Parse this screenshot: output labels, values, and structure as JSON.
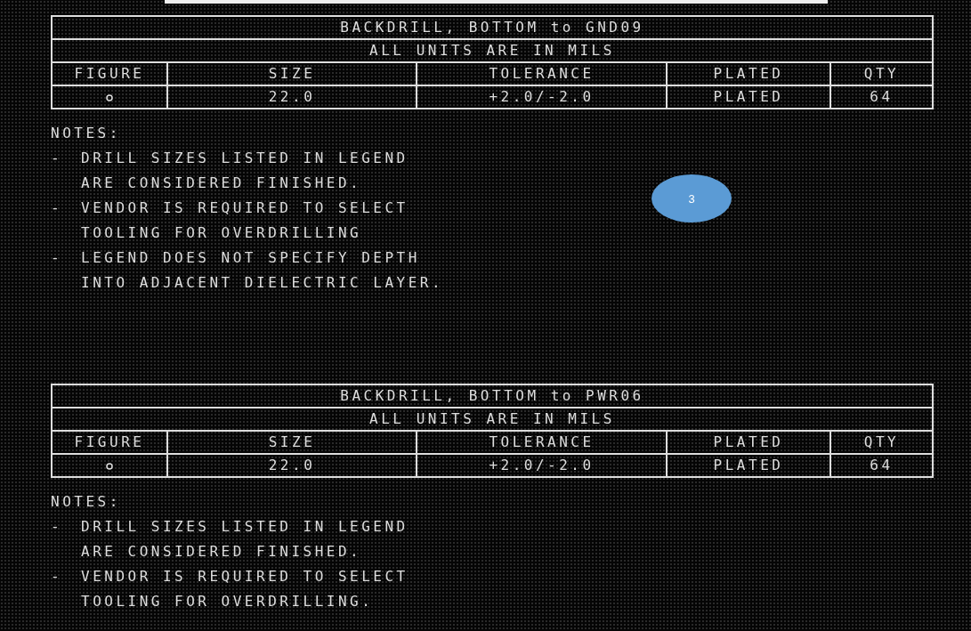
{
  "sections": [
    {
      "table": {
        "title": "BACKDRILL, BOTTOM to GND09",
        "subtitle": "ALL UNITS ARE IN MILS",
        "columns": [
          "FIGURE",
          "SIZE",
          "TOLERANCE",
          "PLATED",
          "QTY"
        ],
        "rows": [
          {
            "cells": [
              {
                "kind": "circle"
              },
              {
                "text": "22.0"
              },
              {
                "text": "+2.0/-2.0"
              },
              {
                "text": "PLATED"
              },
              {
                "text": "64"
              }
            ]
          }
        ]
      },
      "notes": {
        "heading": "NOTES:",
        "items": [
          {
            "lines": [
              "DRILL SIZES LISTED IN LEGEND",
              "ARE CONSIDERED FINISHED."
            ]
          },
          {
            "lines": [
              "VENDOR IS REQUIRED TO SELECT",
              "TOOLING FOR OVERDRILLING"
            ]
          },
          {
            "lines": [
              "LEGEND DOES NOT SPECIFY DEPTH",
              "INTO ADJACENT DIELECTRIC LAYER."
            ]
          }
        ]
      }
    },
    {
      "table": {
        "title": "BACKDRILL, BOTTOM to PWR06",
        "subtitle": "ALL UNITS ARE IN MILS",
        "columns": [
          "FIGURE",
          "SIZE",
          "TOLERANCE",
          "PLATED",
          "QTY"
        ],
        "rows": [
          {
            "cells": [
              {
                "kind": "circle"
              },
              {
                "text": "22.0"
              },
              {
                "text": "+2.0/-2.0"
              },
              {
                "text": "PLATED"
              },
              {
                "text": "64"
              }
            ]
          }
        ]
      },
      "notes": {
        "heading": "NOTES:",
        "items": [
          {
            "lines": [
              "DRILL SIZES LISTED IN LEGEND",
              "ARE CONSIDERED FINISHED."
            ]
          },
          {
            "lines": [
              "VENDOR IS REQUIRED TO SELECT",
              "TOOLING FOR OVERDRILLING."
            ]
          }
        ]
      }
    }
  ],
  "badge": {
    "label": "3"
  },
  "bullet": "-"
}
